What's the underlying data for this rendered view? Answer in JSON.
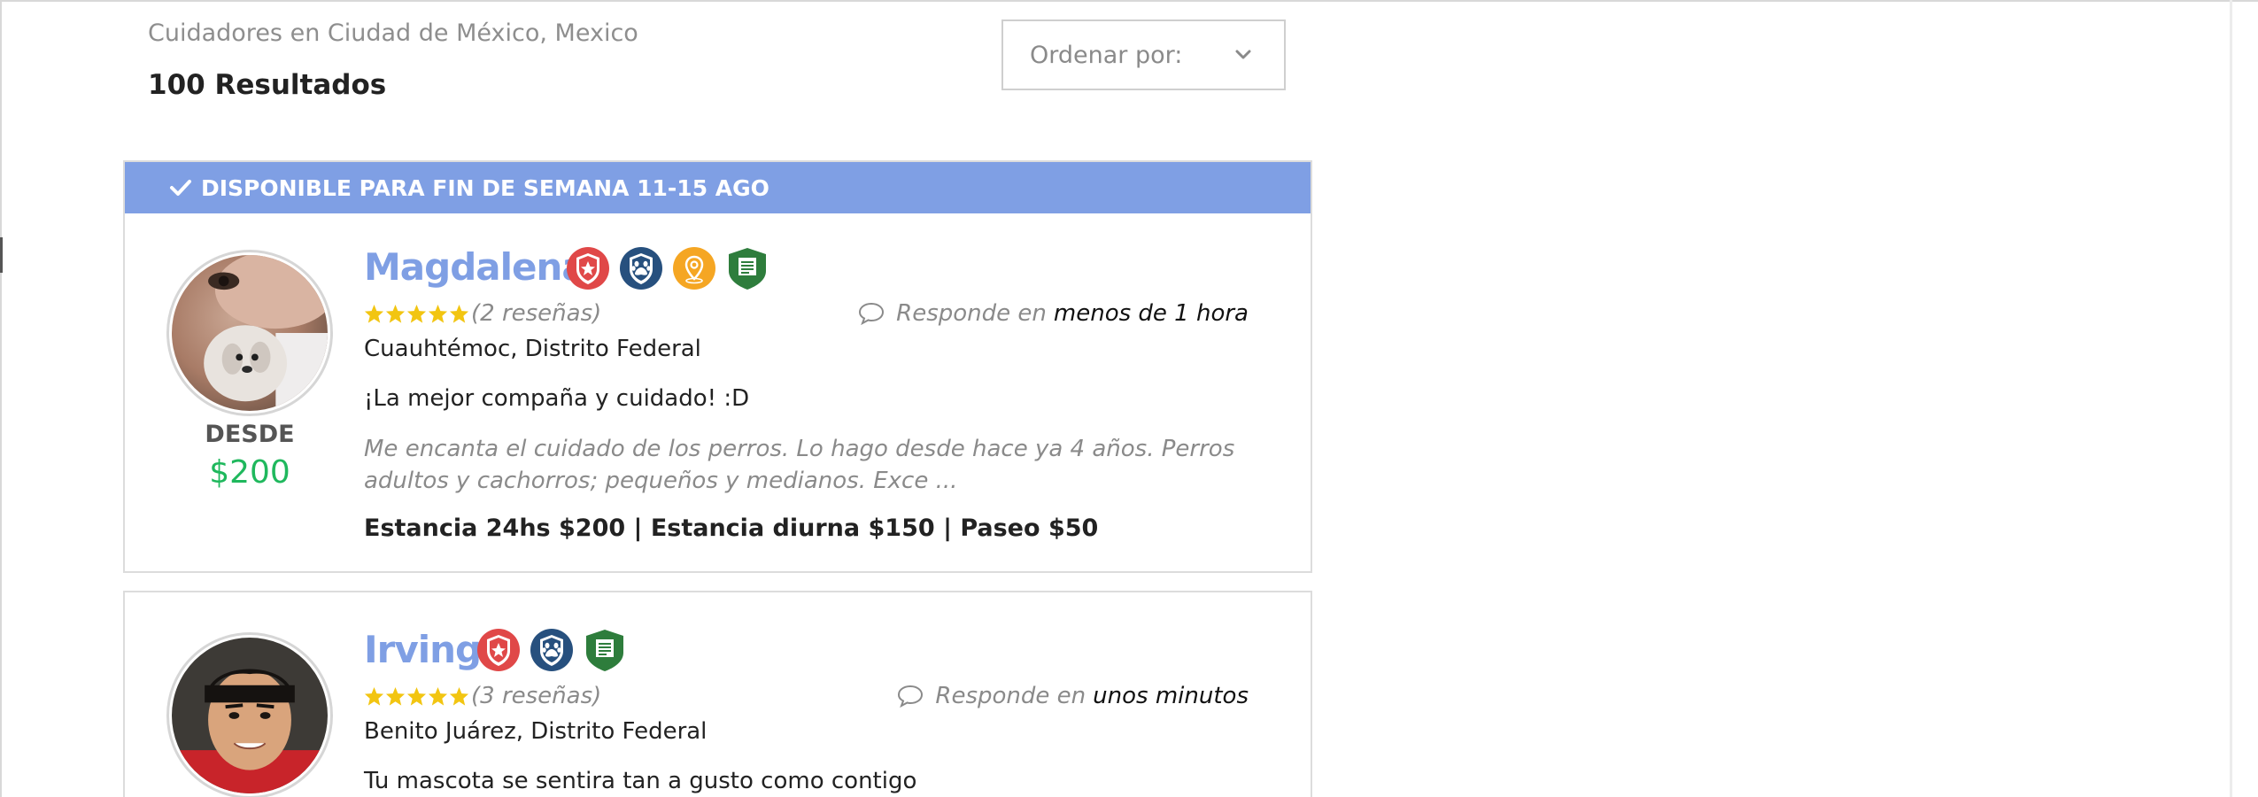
{
  "header": {
    "location_text": "Cuidadores en Ciudad de México, Mexico",
    "results_count": "100 Resultados",
    "sort": {
      "label": "Ordenar por:",
      "icon": "chevron-down-icon"
    }
  },
  "colors": {
    "accent": "#7f9fe4",
    "price_green": "#1fb85d",
    "star_yellow": "#f2c511",
    "muted_text": "#8a8a8a"
  },
  "sitters": [
    {
      "banner": "DISPONIBLE PARA FIN DE SEMANA 11-15 AGO",
      "name": "Magdalena",
      "badges": [
        "red-star-shield-icon",
        "blue-paw-shield-icon",
        "orange-location-pin-icon",
        "green-document-shield-icon"
      ],
      "rating": 5,
      "reviews": "(2 reseñas)",
      "response_prefix": "Responde en",
      "response_value": "menos de 1 hora",
      "location": "Cuauhtémoc, Distrito Federal",
      "headline": "¡La mejor compaña y cuidado! :D",
      "description": "Me encanta el cuidado de los perros. Lo hago desde hace ya 4 años. Perros adultos y cachorros; pequeños y medianos. Exce ...",
      "services": "Estancia 24hs $200 | Estancia diurna $150 | Paseo $50",
      "desde_label": "DESDE",
      "desde_price": "$200"
    },
    {
      "name": "Irving",
      "badges": [
        "red-star-shield-icon",
        "blue-paw-shield-icon",
        "green-document-shield-icon"
      ],
      "rating": 5,
      "reviews": "(3 reseñas)",
      "response_prefix": "Responde en",
      "response_value": "unos minutos",
      "location": "Benito Juárez, Distrito Federal",
      "headline": "Tu mascota se sentira tan a gusto como contigo"
    }
  ]
}
